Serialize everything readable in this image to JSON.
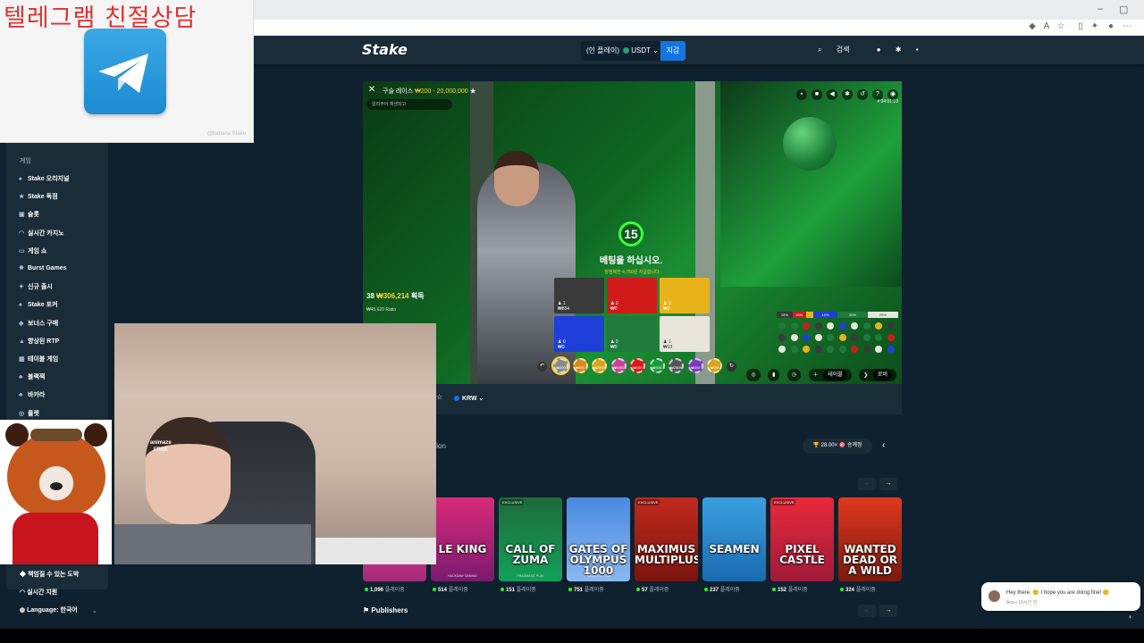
{
  "browser": {
    "minimize": "–",
    "maximize": "▢",
    "close": "✕"
  },
  "overlay": {
    "title": "텔레그램 친절상담",
    "sub": "@banana  Stake"
  },
  "topnav": {
    "logo": "Stake",
    "wallet_mode": "(인 플레이)",
    "currency": "USDT",
    "wallet_button": "지갑",
    "search": "검색"
  },
  "sidebar": {
    "category": "게임",
    "items": [
      {
        "icon": "spade-icon",
        "label": "Stake 오리지널"
      },
      {
        "icon": "star-icon",
        "label": "Stake 독점"
      },
      {
        "icon": "slot-icon",
        "label": "슬롯"
      },
      {
        "icon": "headset-icon",
        "label": "실시간 카지노"
      },
      {
        "icon": "tv-icon",
        "label": "게임 쇼"
      },
      {
        "icon": "burst-icon",
        "label": "Burst Games"
      },
      {
        "icon": "new-icon",
        "label": "신규 출시"
      },
      {
        "icon": "spade-icon",
        "label": "Stake 포커"
      },
      {
        "icon": "gift-icon",
        "label": "보너스 구매"
      },
      {
        "icon": "chart-icon",
        "label": "향상된 RTP"
      },
      {
        "icon": "table-icon",
        "label": "테이블 게임"
      },
      {
        "icon": "cards-icon",
        "label": "블랙잭"
      },
      {
        "icon": "cards-icon",
        "label": "바카라"
      },
      {
        "icon": "roulette-icon",
        "label": "룰렛"
      }
    ],
    "bottom_items": [
      {
        "icon": "shield-icon",
        "label": "책임질 수 있는 도박"
      },
      {
        "icon": "headset-icon",
        "label": "실시간 지원"
      },
      {
        "icon": "globe-icon",
        "label": "Language: 한국어"
      }
    ]
  },
  "video": {
    "game_title": "구슬 레이스",
    "bet_range": "₩200 - 20,000,000",
    "subtitle": "알려주어 재생되고",
    "game_id": "# 04:01:13",
    "timer": "15",
    "bet_prompt": "베팅을 하십시오.",
    "limit_text": "당첨제한 4,750원 지급합니다",
    "winners_count": "38",
    "winners_amount": "₩306,214",
    "winners_label": "획득",
    "ratio_text": "₩45,620 Ratio",
    "cells": [
      {
        "color": "#3a3a3a",
        "line1": "♟ 1",
        "line2": "₩834"
      },
      {
        "color": "#d11a1a",
        "line1": "♟ 0",
        "line2": "₩0"
      },
      {
        "color": "#e8b21a",
        "line1": "♟ 0",
        "line2": "₩0"
      },
      {
        "color": "#1f3fd8",
        "line1": "♟ 0",
        "line2": "₩0"
      },
      {
        "color": "#1f7a3c",
        "line1": "♟ 0",
        "line2": "₩0"
      },
      {
        "color": "#e8e6dc",
        "line1": "♟ 1",
        "line2": "₩13"
      }
    ],
    "chips": [
      {
        "label": "₩200",
        "color": "#8a8a8a"
      },
      {
        "label": "₩500",
        "color": "#d88a1a"
      },
      {
        "label": "₩2000",
        "color": "#d8a51a"
      },
      {
        "label": "₩5000",
        "color": "#c8449a"
      },
      {
        "label": "₩10K",
        "color": "#d81a1a"
      },
      {
        "label": "₩50K",
        "color": "#1a9a3a"
      },
      {
        "label": "₩250K",
        "color": "#555555"
      },
      {
        "label": "₩1M",
        "color": "#7a3ab8"
      },
      {
        "label": "₩2M",
        "color": "#d8a51a"
      }
    ],
    "pct": [
      {
        "label": "15%",
        "color": "#3a3a3a"
      },
      {
        "label": "16%",
        "color": "#d11a1a"
      },
      {
        "label": "",
        "color": "#e8b21a"
      },
      {
        "label": "15%",
        "color": "#1f3fd8"
      },
      {
        "label": "30%",
        "color": "#1f7a3c"
      },
      {
        "label": "25%",
        "color": "#e8e6dc"
      }
    ],
    "bet_button": "테이블",
    "lobby_button": "로비",
    "undo_label": "되돌리기",
    "total_label": "총 베팅금",
    "total_value": "₩0"
  },
  "under_bar": {
    "currency": "KRW"
  },
  "sections": {
    "competition": "tion",
    "race_badge": "🏆 28.00× 🎯 승계정",
    "publishers": "Publishers"
  },
  "games": [
    {
      "name": "1000",
      "exclusive": false,
      "count": "1,096",
      "publisher": "",
      "bg": "linear-gradient(#e04aa0,#a62a78)"
    },
    {
      "name": "LE KING",
      "exclusive": false,
      "count": "514",
      "publisher": "HACKSAW GAMING",
      "bg": "linear-gradient(#d92a7a,#7a1a6e)"
    },
    {
      "name": "CALL OF ZUMA",
      "exclusive": true,
      "count": "151",
      "publisher": "PRAGMATIC PLAY",
      "bg": "linear-gradient(#1e6a3a,#12a05a)"
    },
    {
      "name": "GATES OF OLYMPUS 1000",
      "exclusive": false,
      "count": "751",
      "publisher": "PRAGMATIC PLAY",
      "bg": "linear-gradient(#4a8ae0,#8ab8f0)"
    },
    {
      "name": "MAXIMUS MULTIPLUS",
      "exclusive": true,
      "count": "57",
      "publisher": "",
      "bg": "linear-gradient(#c22a1e,#7a140e)"
    },
    {
      "name": "SEAMEN",
      "exclusive": false,
      "count": "237",
      "publisher": "",
      "bg": "linear-gradient(#3aa0e0,#1a6ab0)"
    },
    {
      "name": "PIXEL CASTLE",
      "exclusive": true,
      "count": "152",
      "publisher": "",
      "bg": "linear-gradient(#e82a3a,#a01a3a)"
    },
    {
      "name": "WANTED DEAD OR A WILD",
      "exclusive": false,
      "count": "324",
      "publisher": "",
      "bg": "linear-gradient(#e0381e,#7a1a0e)"
    }
  ],
  "players_label": "플레이중",
  "exclusive_label": "EXCLUSIVE",
  "webcam": {
    "watermark_top": "animaze",
    "watermark_bottom": "FREE"
  },
  "chat": {
    "message": "Hey there. 😊 I hope you are doing fine! 😊",
    "meta": "Ana • 15시간 전"
  }
}
